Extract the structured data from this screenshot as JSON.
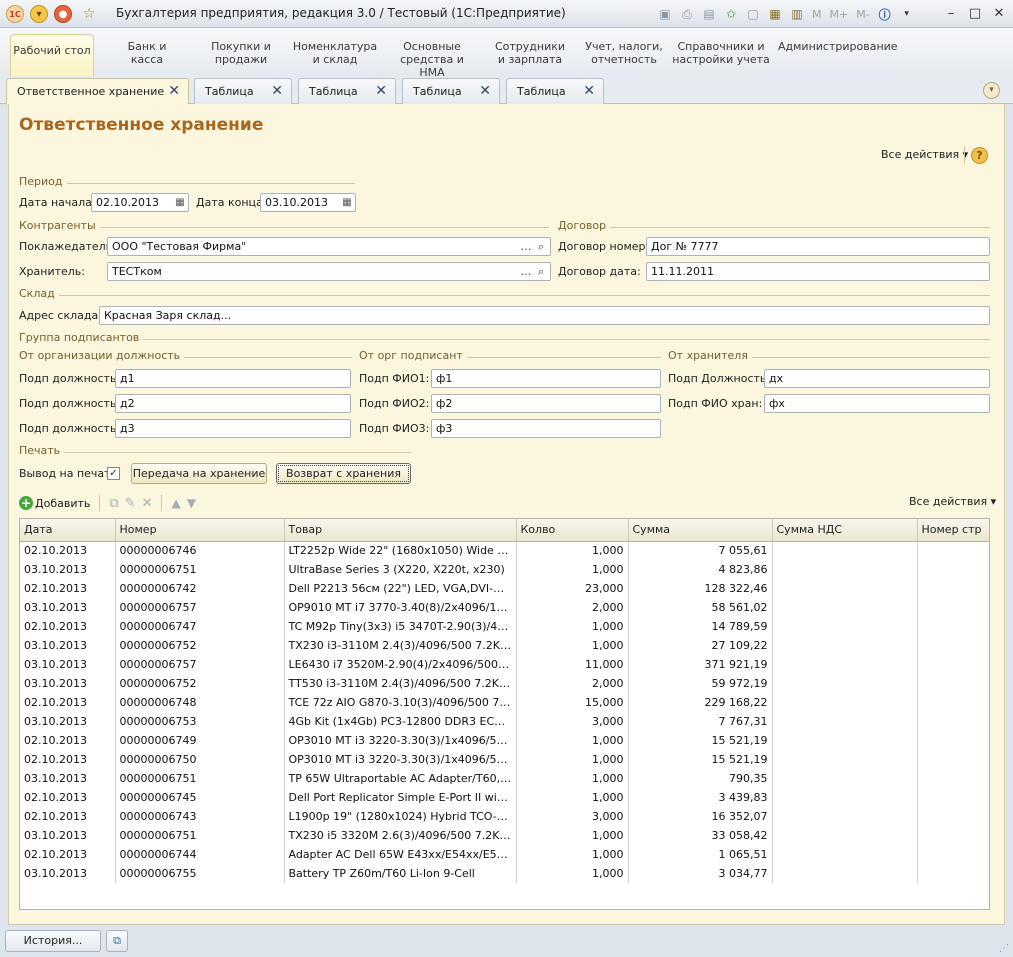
{
  "window": {
    "title": "Бухгалтерия предприятия, редакция 3.0 / Тестовый  (1С:Предприятие)",
    "toolbar_text": [
      "M",
      "M+",
      "M-"
    ]
  },
  "sections": [
    {
      "label": "Рабочий стол",
      "active": true
    },
    {
      "label": "Банк и касса"
    },
    {
      "label": "Покупки и продажи"
    },
    {
      "label": "Номенклатура и склад"
    },
    {
      "label": "Основные средства и НМА"
    },
    {
      "label": "Сотрудники и зарплата"
    },
    {
      "label": "Учет, налоги, отчетность"
    },
    {
      "label": "Справочники и настройки учета"
    },
    {
      "label": "Администрирование"
    }
  ],
  "tabs": [
    {
      "label": "Ответственное хранение",
      "active": true
    },
    {
      "label": "Таблица"
    },
    {
      "label": "Таблица"
    },
    {
      "label": "Таблица"
    },
    {
      "label": "Таблица"
    }
  ],
  "form": {
    "title": "Ответственное хранение",
    "all_actions": "Все действия",
    "help": "?",
    "period": {
      "group": "Период",
      "start_label": "Дата начала:",
      "start_value": "02.10.2013",
      "end_label": "Дата конца:",
      "end_value": "03.10.2013"
    },
    "counterparties": {
      "group": "Контрагенты",
      "depositor_label": "Поклажедатель:",
      "depositor_value": "ООО \"Тестовая Фирма\"",
      "keeper_label": "Хранитель:",
      "keeper_value": "ТЕСТком"
    },
    "contract": {
      "group": "Договор",
      "number_label": "Договор номер:",
      "number_value": "Дог № 7777",
      "date_label": "Договор дата:",
      "date_value": "11.11.2011"
    },
    "warehouse": {
      "group": "Склад",
      "address_label": "Адрес склада:",
      "address_value": "Красная Заря склад..."
    },
    "signers": {
      "group": "Группа подписантов",
      "org_positions": {
        "group": "От организации должность",
        "rows": [
          {
            "label": "Подп должность1:",
            "value": "д1"
          },
          {
            "label": "Подп должность3:",
            "value": "д2"
          },
          {
            "label": "Подп должность2:",
            "value": "д3"
          }
        ]
      },
      "org_signer": {
        "group": "От орг подписант",
        "rows": [
          {
            "label": "Подп ФИО1:",
            "value": "ф1"
          },
          {
            "label": "Подп ФИО2:",
            "value": "ф2"
          },
          {
            "label": "Подп ФИО3:",
            "value": "ф3"
          }
        ]
      },
      "keeper": {
        "group": "От хранителя",
        "rows": [
          {
            "label": "Подп Должность:",
            "value": "дх"
          },
          {
            "label": "Подп ФИО хран:",
            "value": "фх"
          }
        ]
      }
    },
    "print": {
      "group": "Печать",
      "output_label": "Вывод на печать:",
      "output_checked": true,
      "transfer_button": "Передача на хранение",
      "return_button": "Возврат с хранения"
    },
    "table_toolbar": {
      "add_label": "Добавить",
      "all_actions": "Все действия"
    },
    "table": {
      "columns": [
        "Дата",
        "Номер",
        "Товар",
        "Колво",
        "Сумма",
        "Сумма НДС",
        "Номер стр"
      ],
      "rows": [
        [
          "02.10.2013",
          "00000006746",
          "LT2252p Wide 22\" (1680x1050) Wide Hybrid...",
          "1,000",
          "7 055,61",
          "",
          ""
        ],
        [
          "03.10.2013",
          "00000006751",
          "UltraBase Series 3 (X220, X220t, x230)",
          "1,000",
          "4 823,86",
          "",
          ""
        ],
        [
          "02.10.2013",
          "00000006742",
          "Dell P2213 56см (22\") LED, VGA,DVI-D,DP ...",
          "23,000",
          "128 322,46",
          "",
          ""
        ],
        [
          "03.10.2013",
          "00000006757",
          "OP9010 MT i7 3770-3.40(8)/2x4096/1TB-SA...",
          "2,000",
          "58 561,02",
          "",
          ""
        ],
        [
          "02.10.2013",
          "00000006747",
          "TC M92p Tiny(3x3) i5 3470T-2.90(3)/4096/5...",
          "1,000",
          "14 789,59",
          "",
          ""
        ],
        [
          "03.10.2013",
          "00000006752",
          "TX230 i3-3110M 2.4(3)/4096/500 7.2K/12.5...",
          "1,000",
          "27 109,22",
          "",
          ""
        ],
        [
          "03.10.2013",
          "00000006757",
          "LE6430 i7 3520M-2.90(4)/2x4096/500/14.0...",
          "11,000",
          "371 921,19",
          "",
          ""
        ],
        [
          "03.10.2013",
          "00000006752",
          "TT530 i3-3110M 2.4(3)/4096/500 7.2K/15.6...",
          "2,000",
          "59 972,19",
          "",
          ""
        ],
        [
          "02.10.2013",
          "00000006748",
          "TCE 72z AIO G870-3.10(3)/4096/500 7.2K/...",
          "15,000",
          "229 168,22",
          "",
          ""
        ],
        [
          "03.10.2013",
          "00000006753",
          "4Gb Kit (1x4Gb) PC3-12800 DDR3 ECC RDI...",
          "3,000",
          "7 767,31",
          "",
          ""
        ],
        [
          "02.10.2013",
          "00000006749",
          "OP3010 MT i3 3220-3.30(3)/1x4096/500-SA...",
          "1,000",
          "15 521,19",
          "",
          ""
        ],
        [
          "02.10.2013",
          "00000006750",
          "OP3010 MT i3 3220-3.30(3)/1x4096/500-SA...",
          "1,000",
          "15 521,19",
          "",
          ""
        ],
        [
          "03.10.2013",
          "00000006751",
          "TP 65W Ultraportable AC Adapter/T60,X60,...",
          "1,000",
          "790,35",
          "",
          ""
        ],
        [
          "02.10.2013",
          "00000006745",
          "Dell Port Replicator Simple E-Port II with 130...",
          "1,000",
          "3 439,83",
          "",
          ""
        ],
        [
          "02.10.2013",
          "00000006743",
          "L1900p 19\" (1280x1024) Hybrid TCO-03 Black",
          "3,000",
          "16 352,07",
          "",
          ""
        ],
        [
          "03.10.2013",
          "00000006751",
          "TX230 i5 3320M 2.6(3)/4096/500 7.2K/12.5...",
          "1,000",
          "33 058,42",
          "",
          ""
        ],
        [
          "02.10.2013",
          "00000006744",
          "Adapter AC Dell 65W E43xx/E54xx/E55xx/E...",
          "1,000",
          "1 065,51",
          "",
          ""
        ],
        [
          "03.10.2013",
          "00000006755",
          "Battery TP Z60m/T60 Li-Ion 9-Cell",
          "1,000",
          "3 034,77",
          "",
          ""
        ]
      ]
    }
  },
  "statusbar": {
    "history_button": "История..."
  }
}
